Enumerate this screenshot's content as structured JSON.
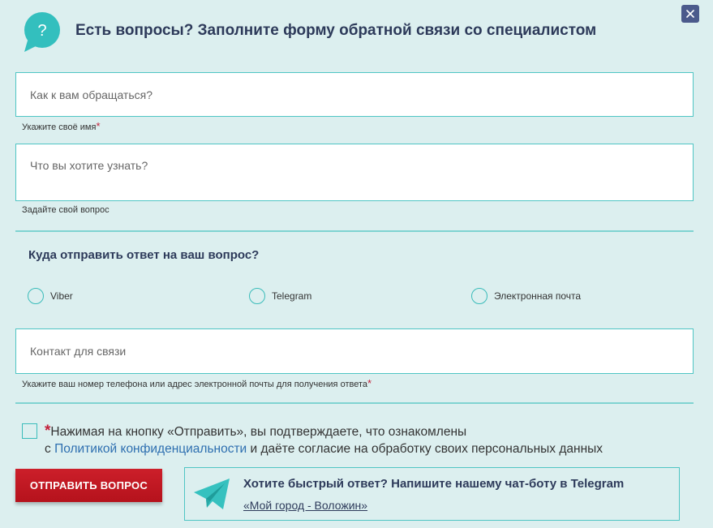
{
  "header": {
    "title": "Есть вопросы? Заполните форму обратной связи со специалистом",
    "icon_glyph": "?"
  },
  "form": {
    "name": {
      "placeholder": "Как к вам обращаться?",
      "hint": "Укажите своё имя",
      "required_mark": "*"
    },
    "question": {
      "placeholder": "Что вы хотите узнать?",
      "hint": "Задайте свой вопрос"
    },
    "reply_section_title": "Куда отправить ответ на ваш вопрос?",
    "reply_options": [
      "Viber",
      "Telegram",
      "Электронная почта"
    ],
    "contact": {
      "placeholder": "Контакт для связи",
      "hint": "Укажите ваш номер телефона или адрес электронной почты для получения ответа",
      "required_mark": "*"
    },
    "consent": {
      "required_mark": "*",
      "line1": "Нажимая на кнопку «Отправить», вы подтверждаете, что ознакомлены",
      "line2_prefix": "с ",
      "policy_link": "Политикой конфиденциальности",
      "line2_suffix": " и даёте согласие на обработку своих персональных данных"
    },
    "submit_label": "ОТПРАВИТЬ ВОПРОС"
  },
  "telegram_promo": {
    "title": "Хотите быстрый ответ? Напишите нашему чат-боту в Telegram",
    "link": "«Мой город - Воложин»"
  },
  "colors": {
    "background": "#dcefef",
    "accent": "#3bbcba",
    "submit": "#c4171f",
    "close": "#4b5a8c",
    "required": "#c3203a"
  }
}
